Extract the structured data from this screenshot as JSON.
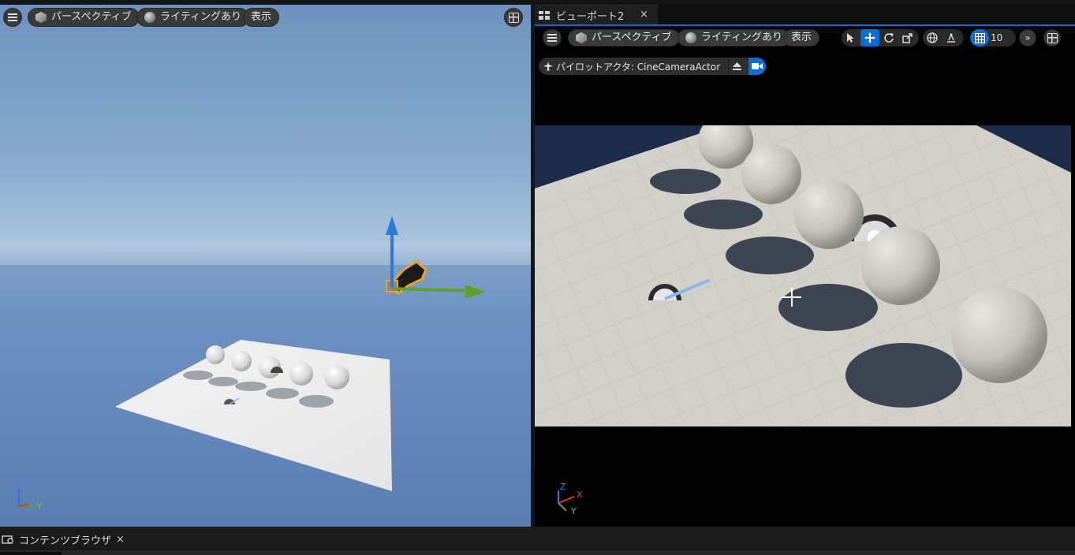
{
  "left_viewport": {
    "toolbar": {
      "perspective_label": "パースペクティブ",
      "lighting_label": "ライティングあり",
      "show_label": "表示"
    },
    "axis": {
      "z": "Z",
      "y": "Y"
    }
  },
  "right_viewport": {
    "tab": {
      "title": "ビューポート2",
      "close": "×"
    },
    "toolbar": {
      "perspective_label": "パースペクティブ",
      "lighting_label": "ライティングあり",
      "show_label": "表示",
      "grid_snap_value": "10"
    },
    "pilot": {
      "label": "パイロットアクタ: CineCameraActor"
    },
    "axis": {
      "z": "Z",
      "x": "X",
      "y": "Y"
    }
  },
  "bottom_bar": {
    "tab_title": "コンテンツブラウザ",
    "close": "×"
  },
  "colors": {
    "accent": "#0a6cd6",
    "gizmo_z": "#2f77d8",
    "gizmo_y": "#5fa02e",
    "selection": "#f0a020"
  },
  "icons": {
    "menu": "menu-icon",
    "perspective": "cube-icon",
    "lighting": "sphere-icon",
    "layout": "viewport-layout-icon",
    "select": "select-arrow-icon",
    "translate": "move-icon",
    "rotate": "rotate-icon",
    "scale": "scale-icon",
    "world": "globe-icon",
    "surface_snap": "surface-snap-icon",
    "grid_snap": "grid-snap-icon",
    "more": "chevron-double-right-icon",
    "pilot": "airplane-icon",
    "eject": "eject-icon",
    "camera": "video-camera-icon",
    "content_browser": "content-browser-icon"
  }
}
